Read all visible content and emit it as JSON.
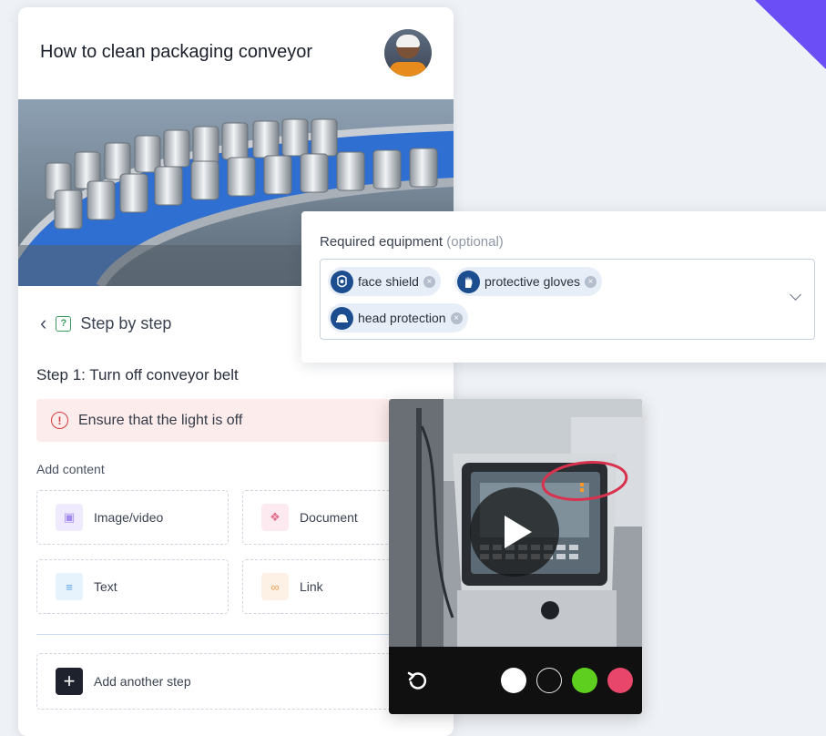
{
  "guide": {
    "title": "How to clean packaging conveyor",
    "nav_label": "Step by step",
    "step_title": "Step 1: Turn off conveyor belt",
    "warning_text": "Ensure that the light is off",
    "add_content_label": "Add content",
    "content_tiles": [
      {
        "label": "Image/video",
        "icon": "camera-icon",
        "color": "#a58bf0"
      },
      {
        "label": "Document",
        "icon": "paperclip-icon",
        "color": "#e36f8f"
      },
      {
        "label": "Text",
        "icon": "text-lines-icon",
        "color": "#5aa7e6"
      },
      {
        "label": "Link",
        "icon": "link-icon",
        "color": "#f0a15c"
      }
    ],
    "add_step_label": "Add another step"
  },
  "equipment": {
    "label": "Required equipment",
    "optional": "(optional)",
    "items": [
      {
        "label": "face shield",
        "icon": "face-shield-icon"
      },
      {
        "label": "protective gloves",
        "icon": "glove-icon"
      },
      {
        "label": "head protection",
        "icon": "helmet-icon"
      }
    ]
  },
  "video": {
    "swatches": [
      {
        "name": "white",
        "color": "#ffffff"
      },
      {
        "name": "black",
        "color": "#111111"
      },
      {
        "name": "green",
        "color": "#5fcf1f"
      },
      {
        "name": "red",
        "color": "#e8466a"
      }
    ],
    "annotation_color": "#d8324e"
  },
  "colors": {
    "accent": "#6b4ef5",
    "conveyor_blue": "#2f6fd1",
    "warning_bg": "#fdecec",
    "warning_icon": "#d83a3a",
    "chip_bg": "#e7eef7",
    "chip_icon_bg": "#1b4d8f"
  }
}
